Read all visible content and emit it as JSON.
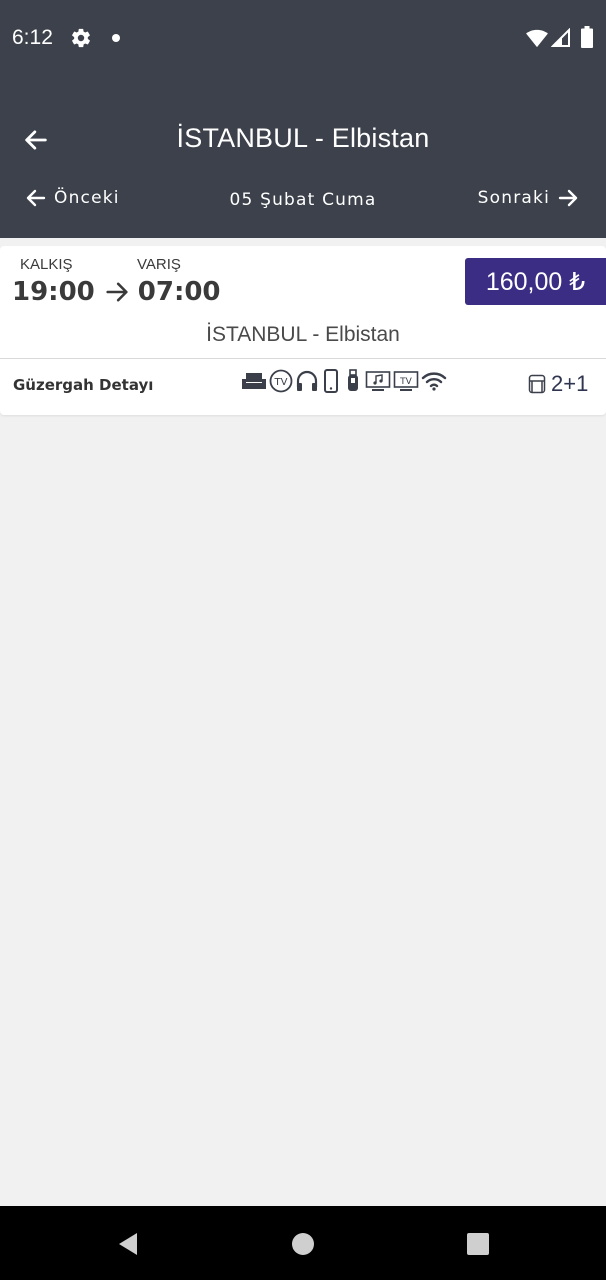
{
  "status_bar": {
    "time": "6:12"
  },
  "app_bar": {
    "title": "İSTANBUL - Elbistan",
    "prev_label": "Önceki",
    "date": "05 Şubat Cuma",
    "next_label": "Sonraki"
  },
  "trip": {
    "departure_label": "KALKIŞ",
    "arrival_label": "VARIŞ",
    "departure_time": "19:00",
    "arrival_time": "07:00",
    "price": "160,00 ₺",
    "route": "İSTANBUL - Elbistan",
    "detail_label": "Güzergah Detayı",
    "seat_layout": "2+1",
    "amenities": [
      "seat-icon",
      "tv-icon",
      "headphones-icon",
      "phone-icon",
      "usb-icon",
      "music-screen-icon",
      "tv-screen-icon",
      "wifi-icon"
    ]
  },
  "colors": {
    "header_bg": "#3c414b",
    "price_bg": "#3b2d84",
    "page_bg": "#f1f1f1"
  }
}
